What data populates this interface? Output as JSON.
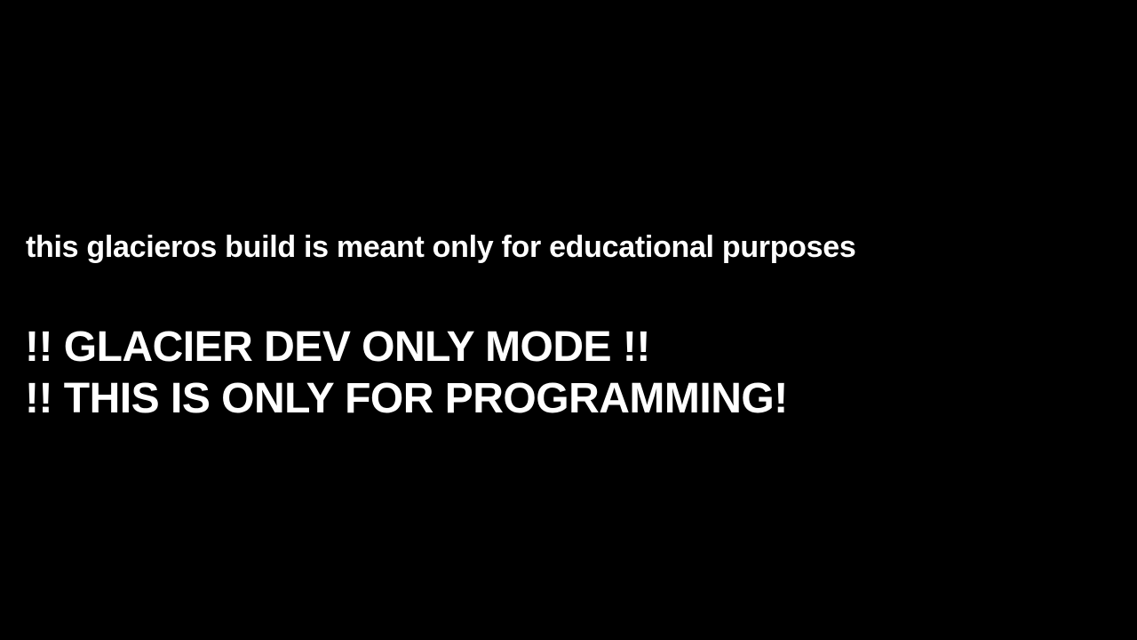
{
  "screen": {
    "background_color": "#000000",
    "text_color": "#ffffff",
    "notice_text": "this glacieros build is meant only for educational purposes",
    "warning_lines": [
      "!! GLACIER DEV ONLY MODE !!",
      "!! THIS IS ONLY FOR PROGRAMMING!"
    ]
  }
}
